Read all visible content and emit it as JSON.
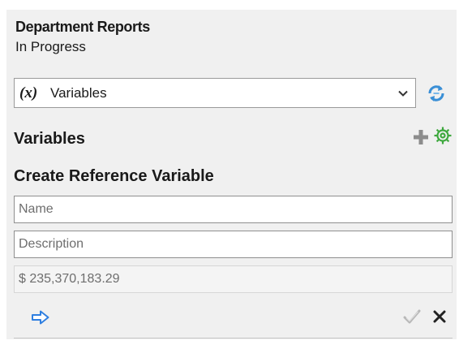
{
  "header": {
    "title": "Department Reports",
    "status": "In Progress"
  },
  "selector": {
    "prefix": "(x)",
    "value": "Variables"
  },
  "variables_section": {
    "title": "Variables"
  },
  "form": {
    "title": "Create Reference Variable",
    "name_placeholder": "Name",
    "description_placeholder": "Description",
    "value_placeholder": "$ 235,370,183.29"
  },
  "icons": {
    "refresh": "refresh-arrows-icon",
    "add": "plus-icon",
    "settings": "gear-icon",
    "next": "right-arrow-icon",
    "confirm": "checkmark-icon",
    "close": "close-x-icon"
  },
  "colors": {
    "panel_background": "#f0f0f0",
    "refresh_blue": "#3a8fd6",
    "add_grey": "#8c8c8c",
    "gear_green": "#3ea83e",
    "next_blue": "#2f7fe0",
    "check_grey": "#b8b8b8",
    "close_dark": "#222222"
  }
}
